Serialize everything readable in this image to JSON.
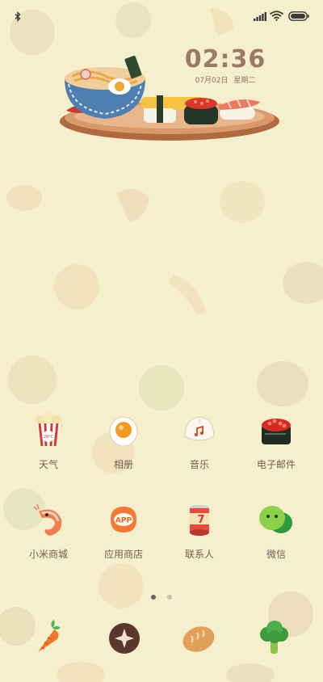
{
  "status_bar": {
    "left_icons": [
      "bluetooth-icon"
    ],
    "right_icons": [
      "signal-icon",
      "wifi-icon",
      "battery-icon"
    ]
  },
  "clock": {
    "time": "02:36",
    "date": "07月02日",
    "weekday": "星期二"
  },
  "apps_row1": [
    {
      "label": "天气",
      "icon": "popcorn-icon"
    },
    {
      "label": "相册",
      "icon": "fried-egg-icon"
    },
    {
      "label": "音乐",
      "icon": "steamed-bun-icon"
    },
    {
      "label": "电子邮件",
      "icon": "sushi-roe-icon"
    }
  ],
  "apps_row2": [
    {
      "label": "小米商城",
      "icon": "shrimp-icon"
    },
    {
      "label": "应用商店",
      "icon": "app-bread-icon"
    },
    {
      "label": "联系人",
      "icon": "can-icon"
    },
    {
      "label": "微信",
      "icon": "green-peas-icon"
    }
  ],
  "popcorn_text": "28℃",
  "app_store_text": "APP",
  "can_text": "7",
  "page_indicator": {
    "count": 2,
    "active": 1
  },
  "dock": [
    {
      "icon": "carrot-icon"
    },
    {
      "icon": "compass-cookie-icon"
    },
    {
      "icon": "bread-icon"
    },
    {
      "icon": "broccoli-icon"
    }
  ],
  "colors": {
    "background": "#f6efcd",
    "clock": "#9a7a66"
  }
}
